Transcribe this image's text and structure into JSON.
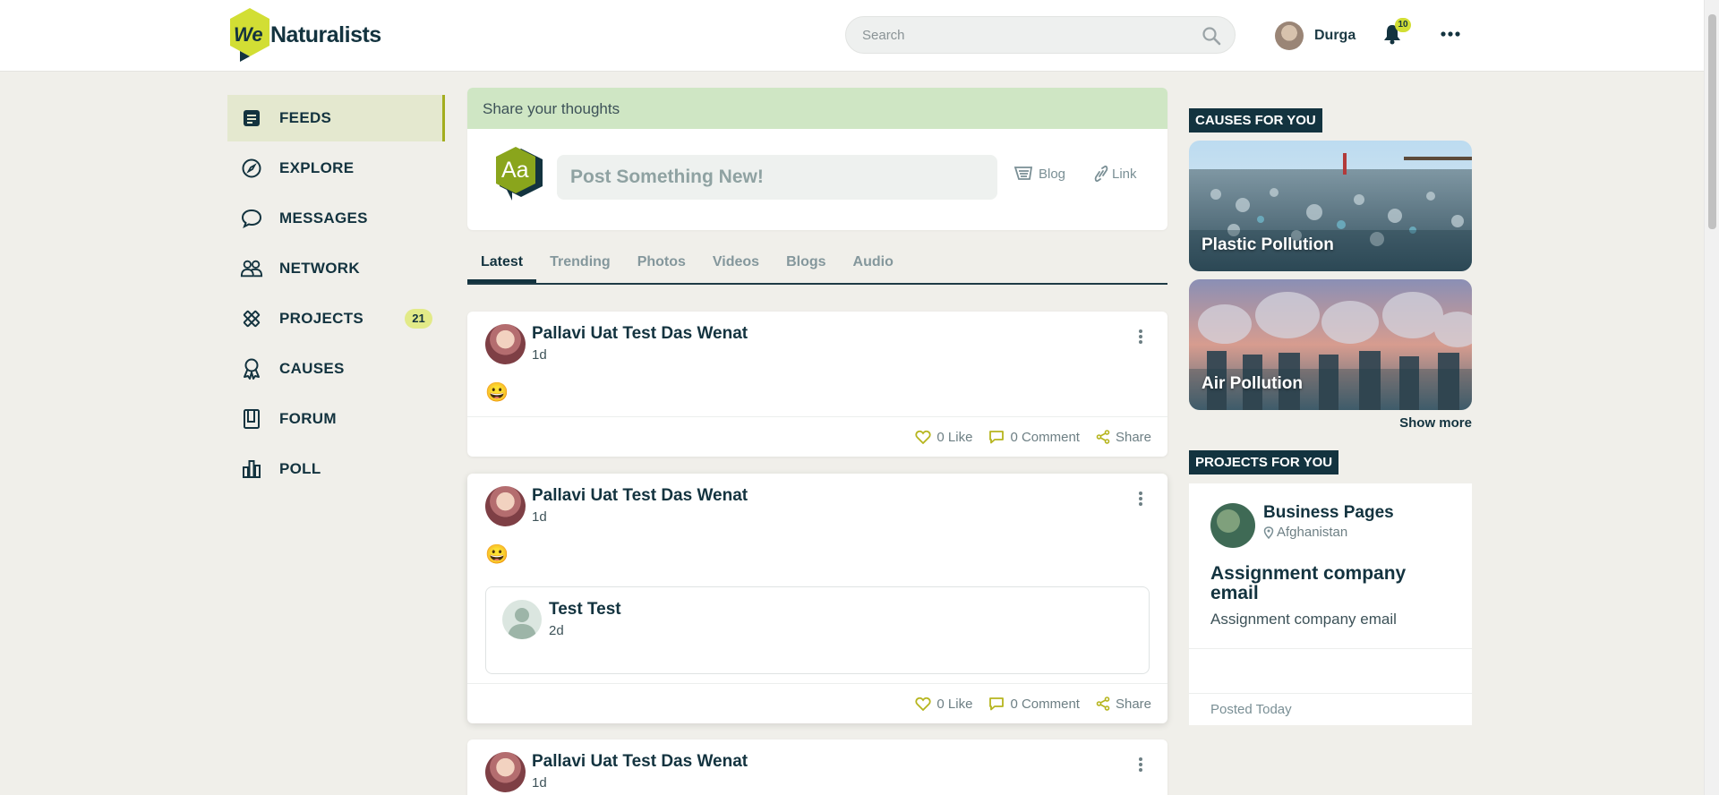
{
  "header": {
    "logo_text": "Naturalists",
    "logo_badge_text": "We",
    "search_placeholder": "Search",
    "user_name": "Durga",
    "notification_count": "10"
  },
  "nav": {
    "items": [
      {
        "label": "FEEDS",
        "icon": "feeds-icon",
        "active": true
      },
      {
        "label": "EXPLORE",
        "icon": "compass-icon"
      },
      {
        "label": "MESSAGES",
        "icon": "chat-bubble-icon"
      },
      {
        "label": "NETWORK",
        "icon": "people-icon"
      },
      {
        "label": "PROJECTS",
        "icon": "pencil-ruler-icon",
        "badge": "21"
      },
      {
        "label": "CAUSES",
        "icon": "ribbon-icon"
      },
      {
        "label": "FORUM",
        "icon": "book-icon"
      },
      {
        "label": "POLL",
        "icon": "bar-chart-icon"
      }
    ]
  },
  "composer": {
    "heading": "Share your thoughts",
    "avatar_text": "Aa",
    "placeholder": "Post Something New!",
    "blog_label": "Blog",
    "link_label": "Link"
  },
  "tabs": [
    "Latest",
    "Trending",
    "Photos",
    "Videos",
    "Blogs",
    "Audio"
  ],
  "active_tab": "Latest",
  "posts": [
    {
      "author": "Pallavi Uat Test Das Wenat",
      "time": "1d",
      "content": "😀",
      "like": "0 Like",
      "comment": "0 Comment",
      "share": "Share"
    },
    {
      "author": "Pallavi Uat Test Das Wenat",
      "time": "1d",
      "content": "😀",
      "like": "0 Like",
      "comment": "0 Comment",
      "share": "Share",
      "shared": {
        "author": "Test Test",
        "time": "2d"
      }
    },
    {
      "author": "Pallavi Uat Test Das Wenat",
      "time": "1d"
    }
  ],
  "right": {
    "causes_title": "CAUSES FOR YOU",
    "causes": [
      {
        "name": "Plastic Pollution"
      },
      {
        "name": "Air Pollution"
      }
    ],
    "show_more": "Show more",
    "projects_title": "PROJECTS FOR YOU",
    "project": {
      "page_name": "Business Pages",
      "location": "Afghanistan",
      "title": "Assignment company email",
      "description": "Assignment company email",
      "posted": "Posted Today"
    }
  },
  "colors": {
    "brand_dark": "#13333f",
    "brand_lime": "#d2de34",
    "composer_header": "#cfe6c4",
    "accent_olive": "#a3ad1f"
  }
}
